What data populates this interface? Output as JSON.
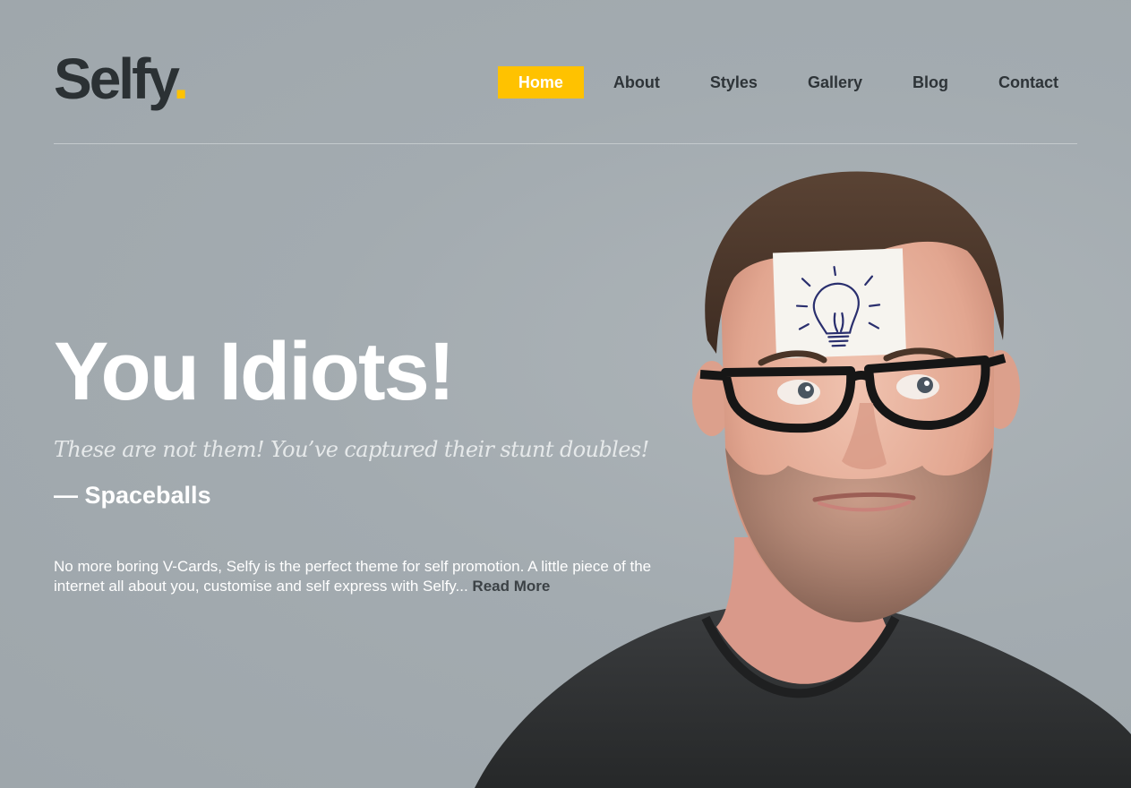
{
  "brand": {
    "name": "Selfy",
    "dot": ".",
    "accent_color": "#ffc200"
  },
  "nav": {
    "items": [
      {
        "label": "Home",
        "active": true
      },
      {
        "label": "About",
        "active": false
      },
      {
        "label": "Styles",
        "active": false
      },
      {
        "label": "Gallery",
        "active": false
      },
      {
        "label": "Blog",
        "active": false
      },
      {
        "label": "Contact",
        "active": false
      }
    ]
  },
  "hero": {
    "headline": "You Idiots!",
    "quote": "These are not them! You’ve captured their stunt doubles!",
    "author": "— Spaceballs",
    "intro": "No more boring V-Cards, Selfy is the perfect theme for self promotion. A little piece of the internet all about you, customise and self express with Selfy... ",
    "read_more": "Read More"
  },
  "colors": {
    "background": "#a1a9ae",
    "text_dark": "#2b3134",
    "text_light": "#ffffff"
  },
  "icons": {
    "portrait": "man-with-lightbulb-sticky-note-photo"
  }
}
